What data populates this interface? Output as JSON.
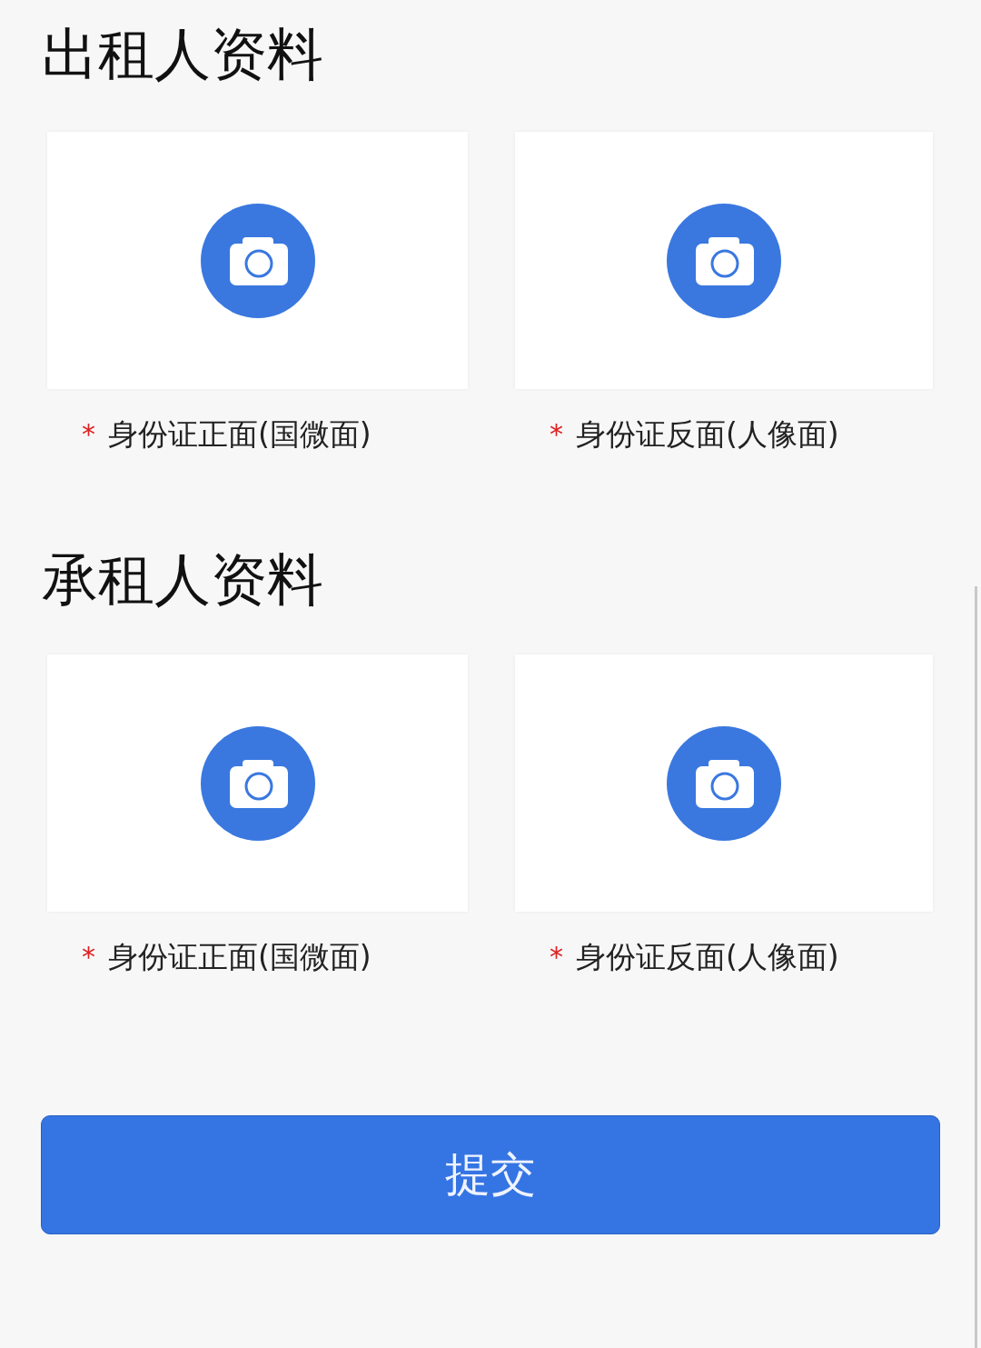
{
  "sections": [
    {
      "title": "出租人资料",
      "uploads": [
        {
          "mark": "*",
          "label": "身份证正面(国微面)"
        },
        {
          "mark": "*",
          "label": "身份证反面(人像面)"
        }
      ]
    },
    {
      "title": "承租人资料",
      "uploads": [
        {
          "mark": "*",
          "label": "身份证正面(国微面)"
        },
        {
          "mark": "*",
          "label": "身份证反面(人像面)"
        }
      ]
    }
  ],
  "submit_button": {
    "label": "提交"
  }
}
